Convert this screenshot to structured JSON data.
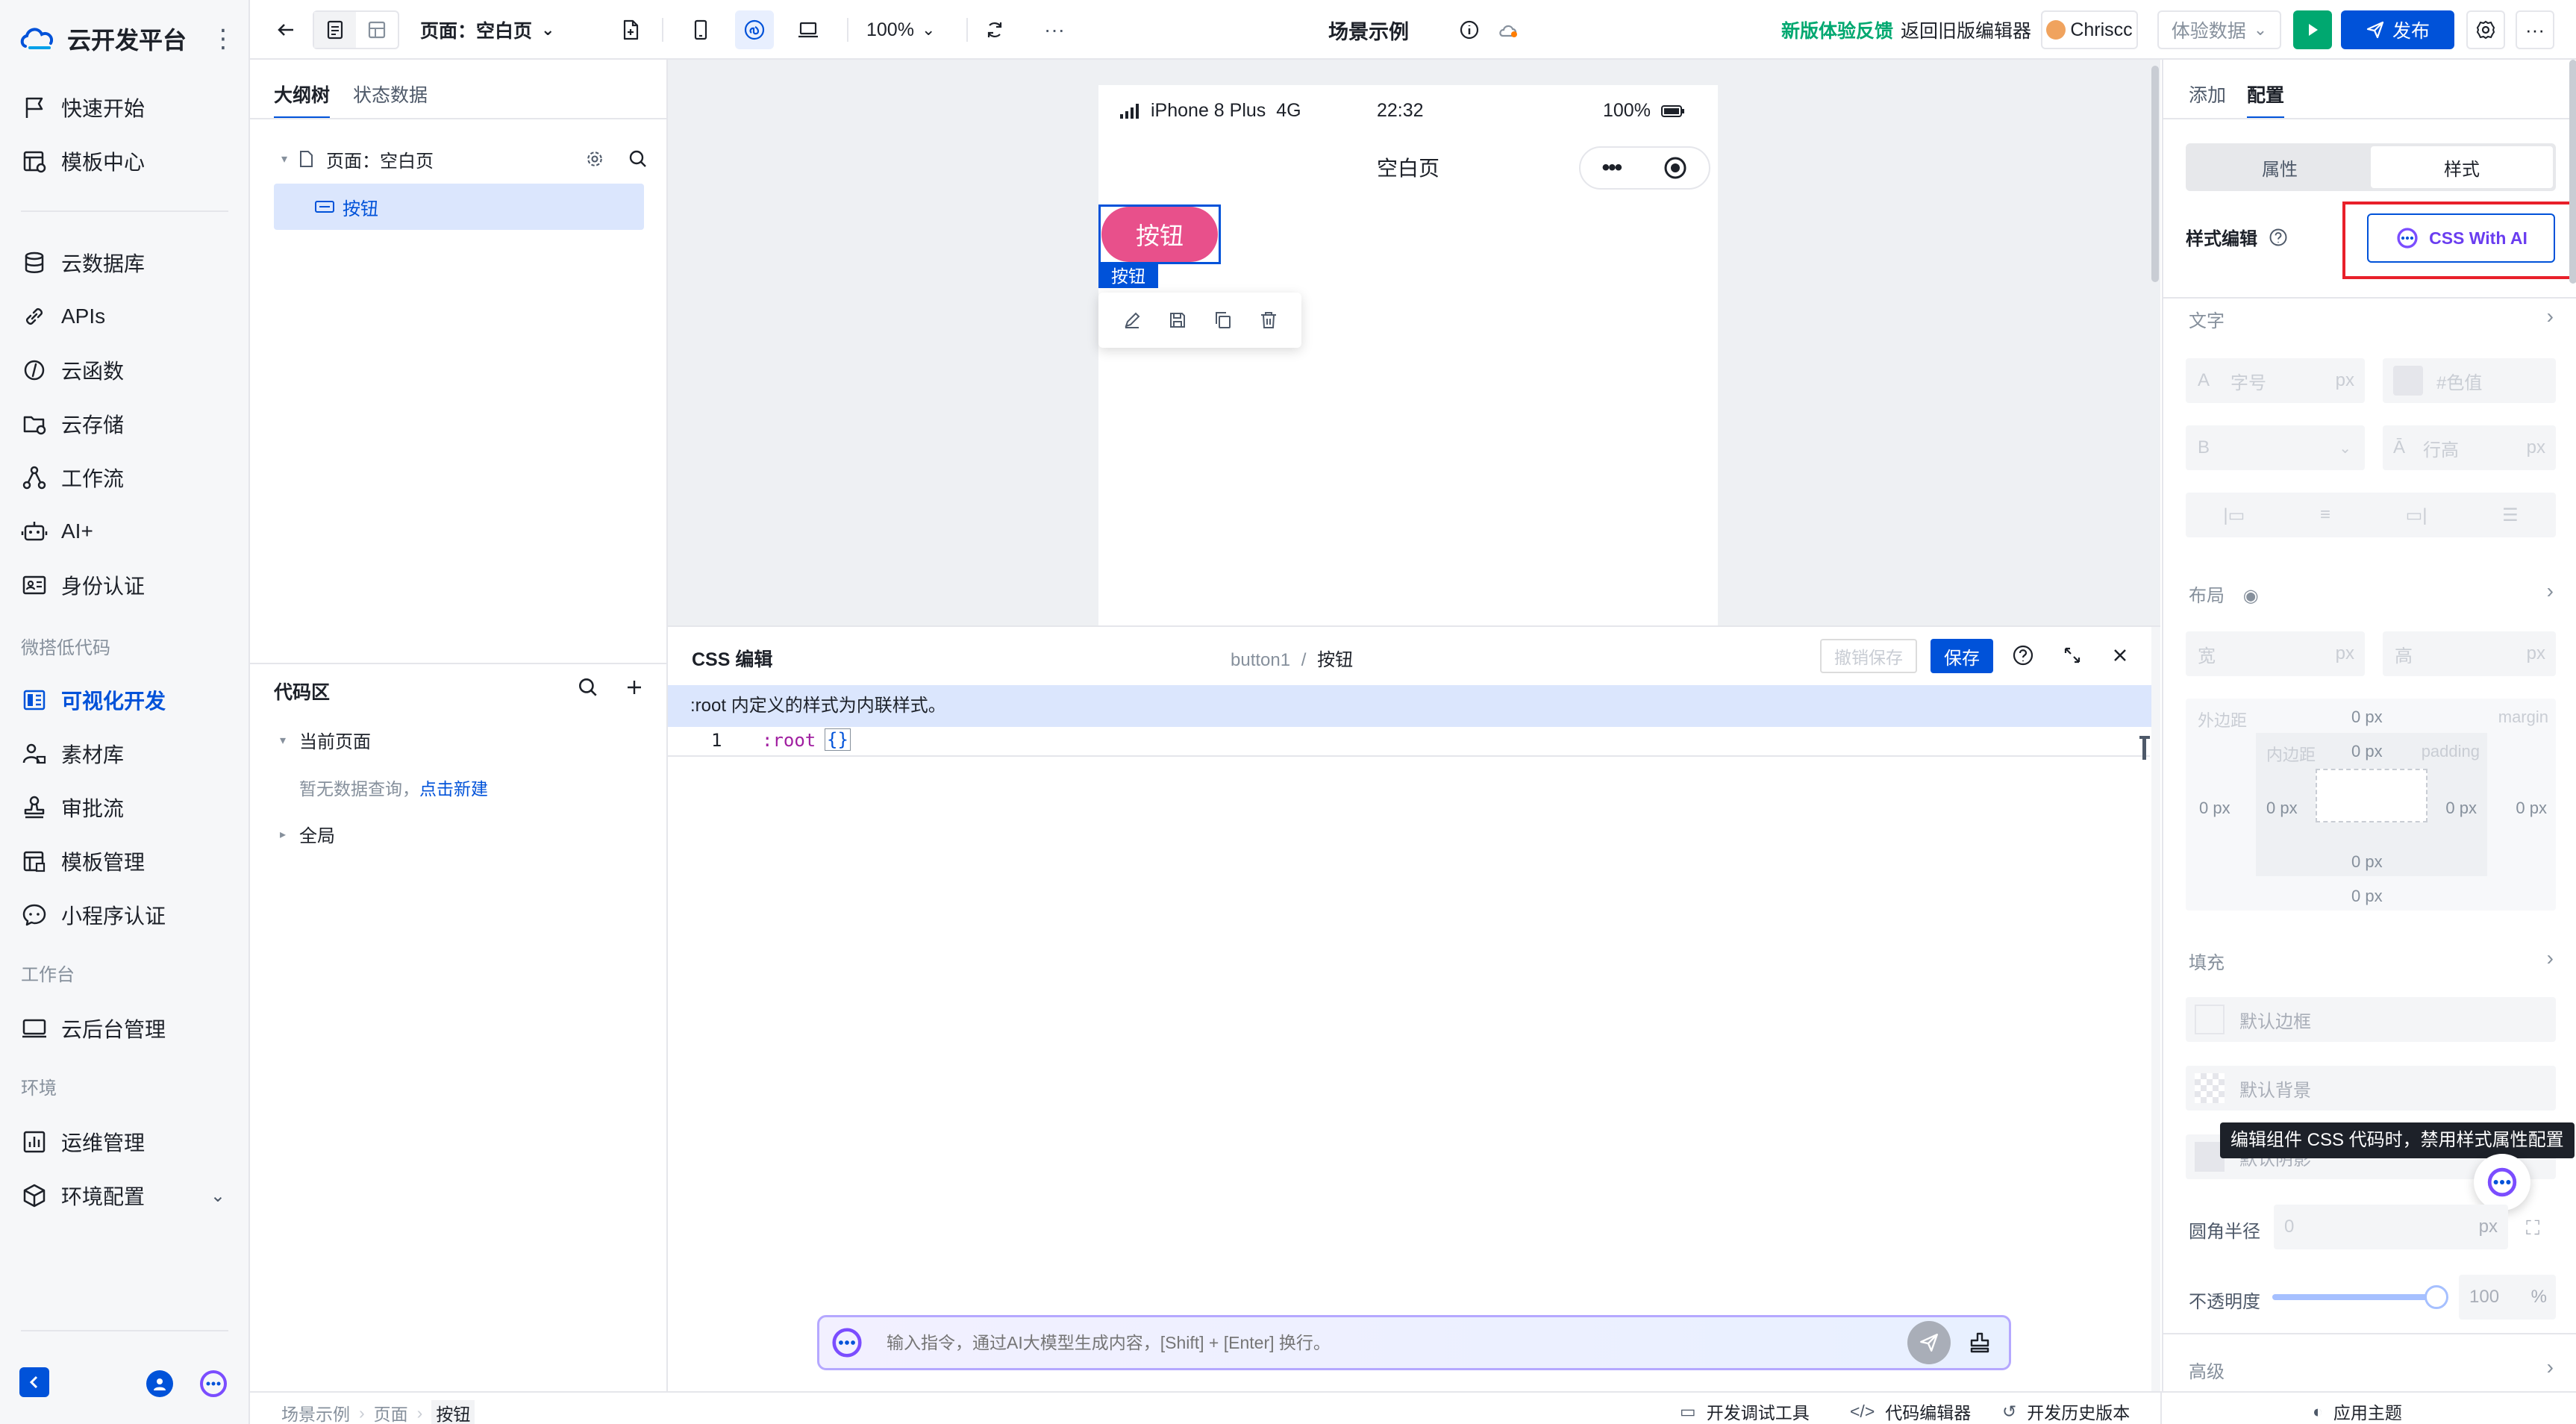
{
  "brand": {
    "name": "云开发平台"
  },
  "sidebar": {
    "group1": [
      {
        "label": "快速开始",
        "icon": "flag-icon"
      },
      {
        "label": "模板中心",
        "icon": "template-icon"
      }
    ],
    "group2": [
      {
        "label": "云数据库",
        "icon": "database-icon"
      },
      {
        "label": "APIs",
        "icon": "link-icon"
      },
      {
        "label": "云函数",
        "icon": "function-icon"
      },
      {
        "label": "云存储",
        "icon": "folder-icon"
      },
      {
        "label": "工作流",
        "icon": "workflow-icon"
      },
      {
        "label": "AI+",
        "icon": "robot-icon"
      },
      {
        "label": "身份认证",
        "icon": "id-card-icon"
      }
    ],
    "section_lowcode": "微搭低代码",
    "group3": [
      {
        "label": "可视化开发",
        "icon": "visual-dev-icon",
        "active": true
      },
      {
        "label": "素材库",
        "icon": "assets-icon"
      },
      {
        "label": "审批流",
        "icon": "stamp-icon"
      },
      {
        "label": "模板管理",
        "icon": "template-manage-icon"
      },
      {
        "label": "小程序认证",
        "icon": "miniprogram-icon"
      }
    ],
    "section_workbench": "工作台",
    "group4": [
      {
        "label": "云后台管理",
        "icon": "monitor-icon"
      }
    ],
    "section_env": "环境",
    "group5": [
      {
        "label": "运维管理",
        "icon": "chart-icon"
      },
      {
        "label": "环境配置",
        "icon": "cube-icon"
      }
    ]
  },
  "topbar": {
    "page_selector": "页面：空白页",
    "zoom": "100%",
    "app_title": "场景示例",
    "feedback": "新版体验反馈",
    "old_editor": "返回旧版编辑器",
    "user": "Chriscc",
    "experience_data": "体验数据",
    "publish": "发布"
  },
  "outline": {
    "tab_tree": "大纲树",
    "tab_state": "状态数据",
    "page_node": "页面：空白页",
    "button_node": "按钮",
    "code_area": "代码区",
    "current_page": "当前页面",
    "empty_prefix": "暂无数据查询，",
    "empty_link": "点击新建",
    "global": "全局"
  },
  "phone": {
    "carrier": "iPhone 8 Plus",
    "network": "4G",
    "time": "22:32",
    "battery": "100%",
    "page_title": "空白页",
    "button_text": "按钮",
    "selection_tag": "按钮"
  },
  "csseditor": {
    "title": "CSS 编辑",
    "crumb_component": "button1",
    "crumb_sep": "/",
    "crumb_label": "按钮",
    "undo_save": "撤销保存",
    "save": "保存",
    "notice": ":root 内定义的样式为内联样式。",
    "line_no": "1",
    "code": ":root",
    "code_braces": "{}",
    "ai_placeholder": "输入指令，通过AI大模型生成内容，[Shift] + [Enter] 换行。"
  },
  "rpanel": {
    "tab_add": "添加",
    "tab_config": "配置",
    "seg_props": "属性",
    "seg_style": "样式",
    "style_edit": "样式编辑",
    "css_ai": "CSS With AI",
    "text_section": "文字",
    "font_size_ph": "字号",
    "unit_px": "px",
    "color_ph": "#色值",
    "line_height_ph": "行高",
    "layout_section": "布局",
    "width_ph": "宽",
    "height_ph": "高",
    "margin_label": "外边距",
    "margin_word": "margin",
    "padding_label": "内边距",
    "padding_word": "padding",
    "zero_px": "0 px",
    "fill_section": "填充",
    "default_border": "默认边框",
    "default_bg": "默认背景",
    "default_shadow": "默认阴影",
    "tooltip": "编辑组件 CSS 代码时，禁用样式属性配置",
    "radius_label": "圆角半径",
    "radius_value": "0",
    "opacity_label": "不透明度",
    "opacity_value": "100",
    "opacity_unit": "%",
    "opacity_level": 1.0,
    "advanced": "高级"
  },
  "statusbar": {
    "crumb1": "场景示例",
    "crumb2": "页面",
    "crumb3": "按钮",
    "debug": "开发调试工具",
    "code_editor": "代码编辑器",
    "history": "开发历史版本",
    "theme": "应用主题"
  }
}
